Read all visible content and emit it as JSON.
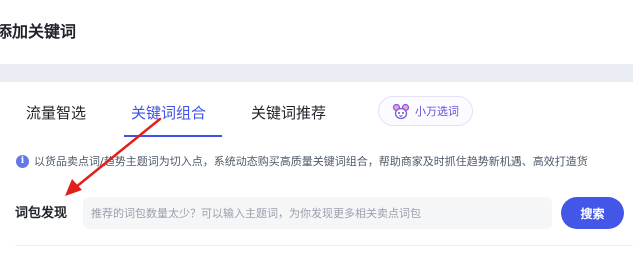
{
  "page": {
    "title": "添加关键词"
  },
  "tabs": [
    {
      "label": "流量智选",
      "active": false
    },
    {
      "label": "关键词组合",
      "active": true
    },
    {
      "label": "关键词推荐",
      "active": false
    }
  ],
  "ai_tool": {
    "label": "小万选词",
    "icon": "mascot-icon"
  },
  "notice": {
    "icon": "info-icon",
    "text": "以货品卖点词/趋势主题词为切入点，系统动态购买高质量关键词组合，帮助商家及时抓住趋势新机遇、高效打造货"
  },
  "search": {
    "label": "词包发现",
    "placeholder": "推荐的词包数量太少？可以输入主题词，为你发现更多相关卖点词包",
    "value": "",
    "button_label": "搜索"
  },
  "colors": {
    "accent": "#3f51e6",
    "button": "#4257e8",
    "annotation_arrow": "#e0201c",
    "band": "#ebedf4"
  }
}
